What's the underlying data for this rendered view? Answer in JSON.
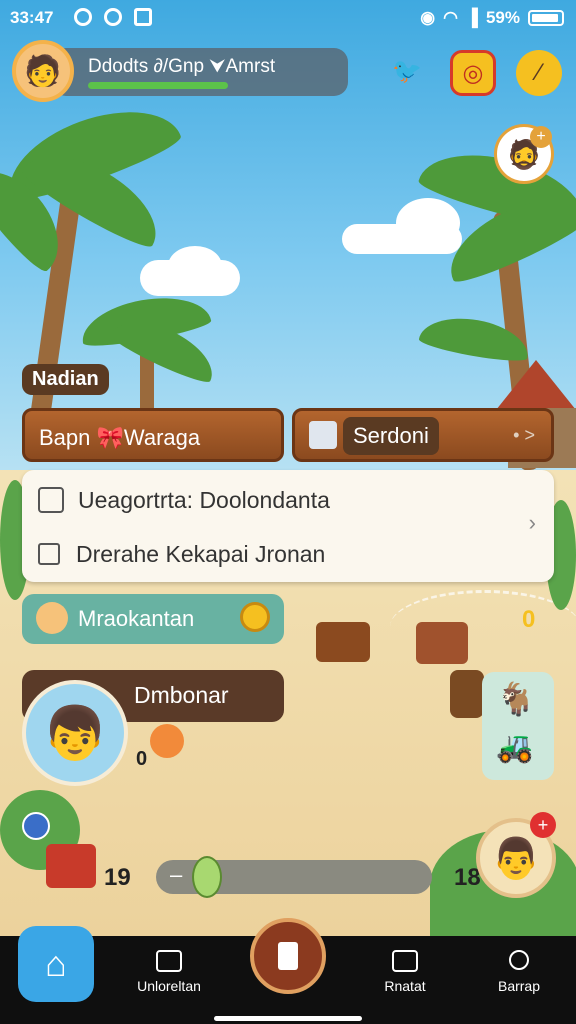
{
  "status_bar": {
    "time": "33:47",
    "battery": "59%",
    "icons": [
      "notification-icon",
      "notification-icon",
      "message-icon",
      "alarm-icon",
      "wifi-icon",
      "signal-icon",
      "battery-icon"
    ]
  },
  "player": {
    "name": "Ddodts ∂/Gnp ⮟Amrst",
    "xp_progress": 0.7
  },
  "top_buttons": [
    "bird-icon",
    "coin-gift-icon",
    "edit-icon"
  ],
  "section_label": "Nadian",
  "action_buttons": {
    "left": "Bapn 🎀Waraga",
    "right": "Serdoni",
    "right_arrows": "• >"
  },
  "menu": {
    "item1": "Ueagortrta: Doolondanta",
    "item2": "Drerahe Kekapai Jronan"
  },
  "quests": {
    "teal": "Mraokantan",
    "brown": "Dmbonar",
    "small_count": "0"
  },
  "counters": {
    "left": "19",
    "right": "18",
    "badge": "0"
  },
  "bottom_nav": {
    "items": [
      {
        "label": "",
        "icon": "home-icon"
      },
      {
        "label": "Unloreltan",
        "icon": "folder-icon"
      },
      {
        "label": "",
        "icon": "center-action-icon"
      },
      {
        "label": "Rnatat",
        "icon": "inventory-icon"
      },
      {
        "label": "Barrap",
        "icon": "search-icon"
      }
    ]
  },
  "colors": {
    "sky": "#3fa9e0",
    "wood": "#8b4a1f",
    "accent_orange": "#f4b24a"
  }
}
